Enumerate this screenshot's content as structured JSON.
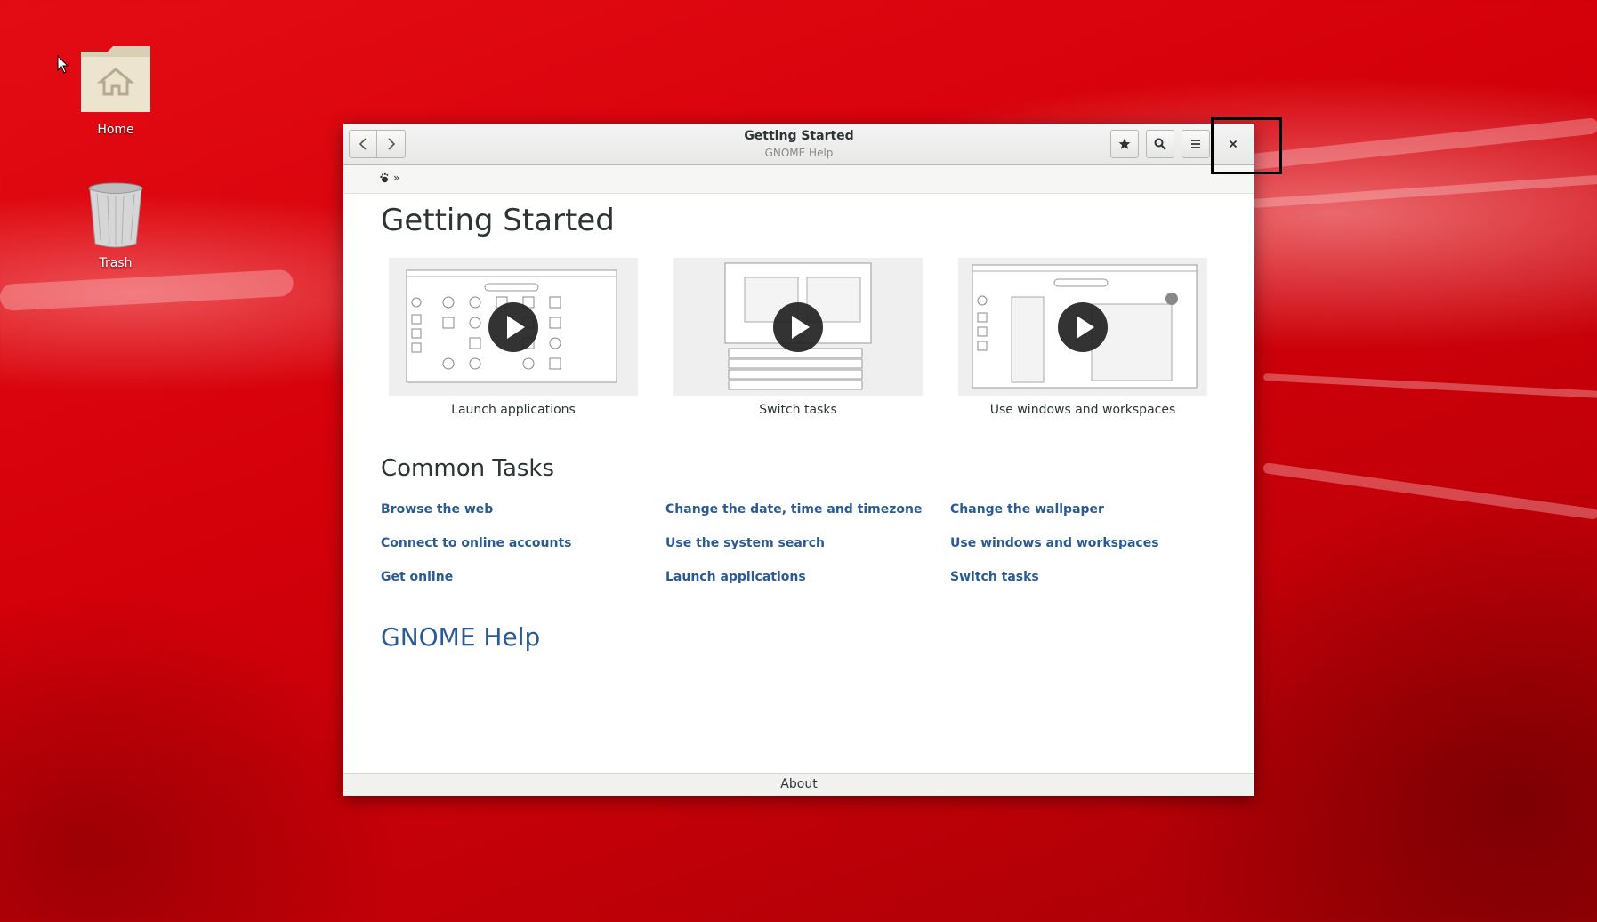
{
  "desktop": {
    "icons": [
      {
        "label": "Home",
        "icon": "home-folder-icon"
      },
      {
        "label": "Trash",
        "icon": "trash-icon"
      }
    ]
  },
  "window": {
    "title": "Getting Started",
    "subtitle": "GNOME Help",
    "breadcrumb_sep": "»"
  },
  "page": {
    "title": "Getting Started",
    "videos": [
      {
        "caption": "Launch applications"
      },
      {
        "caption": "Switch tasks"
      },
      {
        "caption": "Use windows and workspaces"
      }
    ],
    "common_tasks_title": "Common Tasks",
    "tasks": [
      "Browse the web",
      "Connect to online accounts",
      "Get online",
      "Change the date, time and timezone",
      "Use the system search",
      "Launch applications",
      "Change the wallpaper",
      "Use windows and workspaces",
      "Switch tasks"
    ],
    "help_link": "GNOME Help"
  },
  "footer": {
    "about": "About"
  },
  "colors": {
    "link": "#2a5b95",
    "wallpaper": "#d4000a"
  }
}
